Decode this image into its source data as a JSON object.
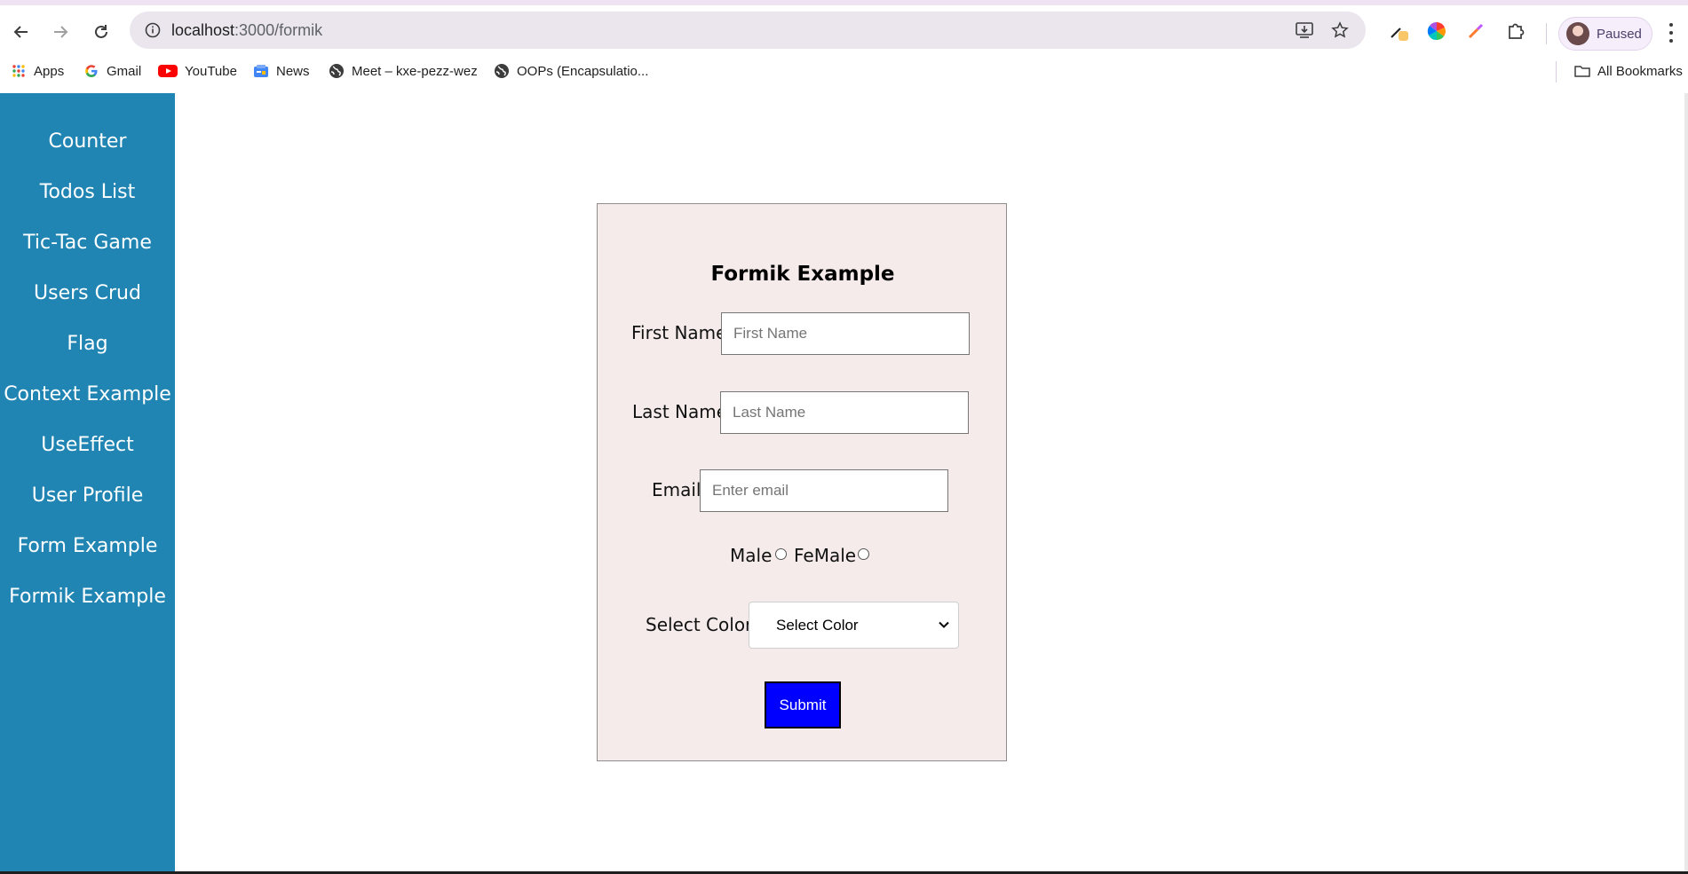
{
  "browser": {
    "url_host": "localhost",
    "url_path": ":3000/formik",
    "profile_label": "Paused",
    "bookmarks": [
      {
        "label": "Apps",
        "icon": "apps-grid-icon"
      },
      {
        "label": "Gmail",
        "icon": "google-icon"
      },
      {
        "label": "YouTube",
        "icon": "youtube-icon"
      },
      {
        "label": "News",
        "icon": "news-icon"
      },
      {
        "label": "Meet – kxe-pezz-wez",
        "icon": "globe-icon"
      },
      {
        "label": "OOPs (Encapsulatio...",
        "icon": "globe-icon"
      }
    ],
    "all_bookmarks_label": "All Bookmarks"
  },
  "sidebar": {
    "items": [
      {
        "label": "Counter"
      },
      {
        "label": "Todos List"
      },
      {
        "label": "Tic-Tac Game"
      },
      {
        "label": "Users Crud"
      },
      {
        "label": "Flag"
      },
      {
        "label": "Context Example"
      },
      {
        "label": "UseEffect"
      },
      {
        "label": "User Profile"
      },
      {
        "label": "Form Example"
      },
      {
        "label": "Formik Example"
      }
    ]
  },
  "form": {
    "title": "Formik Example",
    "first_name": {
      "label": "First Name",
      "placeholder": "First Name",
      "value": ""
    },
    "last_name": {
      "label": "Last Name",
      "placeholder": "Last Name",
      "value": ""
    },
    "email": {
      "label": "Email",
      "placeholder": "Enter email",
      "value": ""
    },
    "gender": {
      "option_male": "Male",
      "option_female": "FeMale"
    },
    "color": {
      "label": "Select Color:",
      "selected": "Select Color"
    },
    "submit_label": "Submit"
  },
  "colors": {
    "sidebar_bg": "#2185b3",
    "card_bg": "#f5ebeb",
    "submit_bg": "#0000ff"
  }
}
